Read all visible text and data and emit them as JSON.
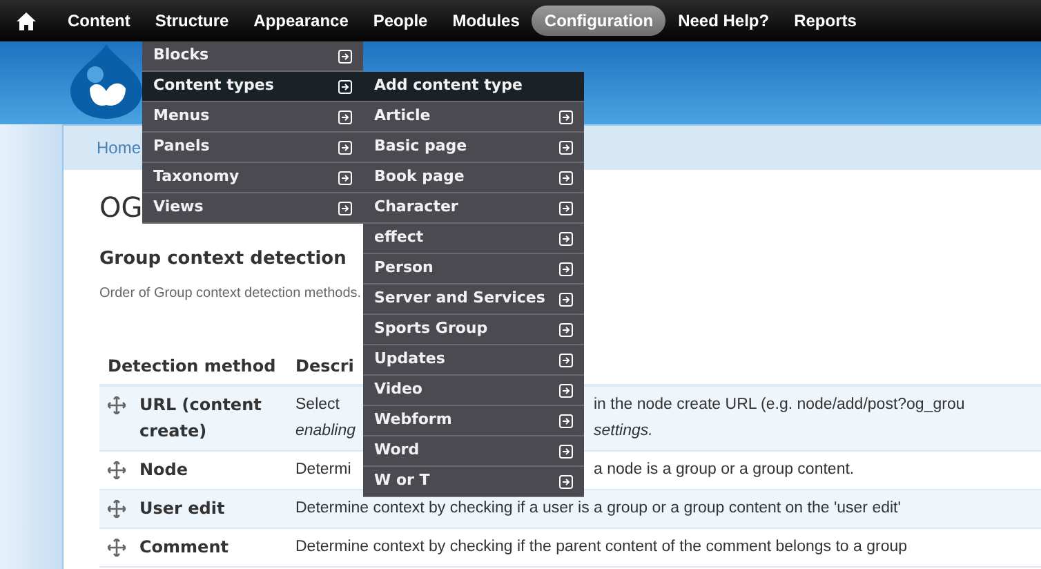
{
  "nav": {
    "items": [
      {
        "label": "Content",
        "selected": false
      },
      {
        "label": "Structure",
        "selected": false
      },
      {
        "label": "Appearance",
        "selected": false
      },
      {
        "label": "People",
        "selected": false
      },
      {
        "label": "Modules",
        "selected": false
      },
      {
        "label": "Configuration",
        "selected": true
      },
      {
        "label": "Need Help?",
        "selected": false
      },
      {
        "label": "Reports",
        "selected": false
      }
    ]
  },
  "structure_menu": {
    "items": [
      {
        "label": "Blocks",
        "highlighted": false,
        "submenu": true
      },
      {
        "label": "Content types",
        "highlighted": true,
        "submenu": true
      },
      {
        "label": "Menus",
        "highlighted": false,
        "submenu": true
      },
      {
        "label": "Panels",
        "highlighted": false,
        "submenu": true
      },
      {
        "label": "Taxonomy",
        "highlighted": false,
        "submenu": true
      },
      {
        "label": "Views",
        "highlighted": false,
        "submenu": true
      }
    ]
  },
  "content_types_menu": {
    "items": [
      {
        "label": "Add content type",
        "highlighted": true,
        "submenu": false
      },
      {
        "label": "Article",
        "highlighted": false,
        "submenu": true
      },
      {
        "label": "Basic page",
        "highlighted": false,
        "submenu": true
      },
      {
        "label": "Book page",
        "highlighted": false,
        "submenu": true
      },
      {
        "label": "Character",
        "highlighted": false,
        "submenu": true
      },
      {
        "label": "effect",
        "highlighted": false,
        "submenu": true
      },
      {
        "label": "Person",
        "highlighted": false,
        "submenu": true
      },
      {
        "label": "Server and Services",
        "highlighted": false,
        "submenu": true
      },
      {
        "label": "Sports Group",
        "highlighted": false,
        "submenu": true
      },
      {
        "label": "Updates",
        "highlighted": false,
        "submenu": true
      },
      {
        "label": "Video",
        "highlighted": false,
        "submenu": true
      },
      {
        "label": "Webform",
        "highlighted": false,
        "submenu": true
      },
      {
        "label": "Word",
        "highlighted": false,
        "submenu": true
      },
      {
        "label": "W or T",
        "highlighted": false,
        "submenu": true
      }
    ]
  },
  "breadcrumb": "Home",
  "page_title": "OG",
  "section": {
    "title": "Group context detection",
    "description": "Order of Group context detection methods."
  },
  "table": {
    "columns": [
      "Detection method",
      "Descri"
    ],
    "rows": [
      {
        "method": "URL (content create)",
        "description": [
          [
            "Select",
            "in the node create URL (e.g. node/add/post?og_grou"
          ],
          [
            "enabling",
            "settings."
          ]
        ]
      },
      {
        "method": "Node",
        "description": [
          [
            "Determi",
            "a node is a group or a group content."
          ]
        ]
      },
      {
        "method": "User edit",
        "description": [
          [
            "Determine context by checking if a user is a group or a group content on the 'user edit'"
          ]
        ]
      },
      {
        "method": "Comment",
        "description": [
          [
            "Determine context by checking if the parent content of the comment belongs to a group"
          ]
        ]
      }
    ]
  }
}
